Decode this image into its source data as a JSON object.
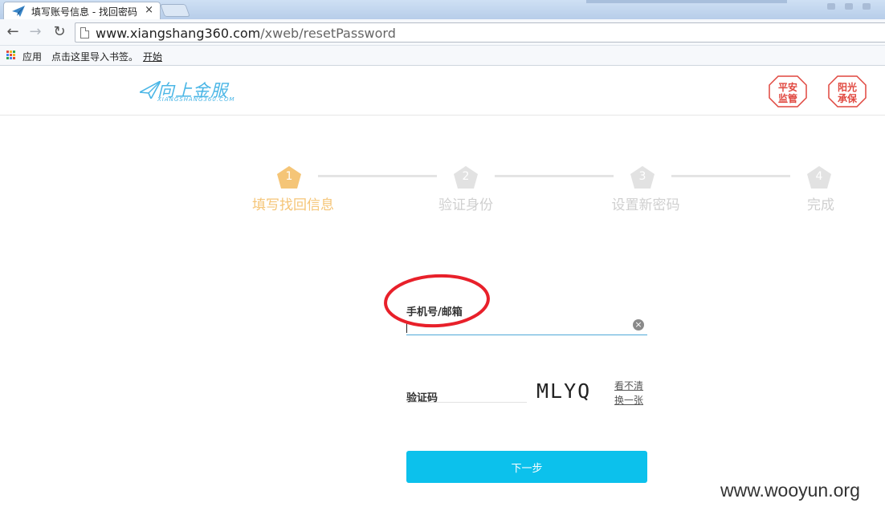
{
  "browser": {
    "tab_title": "填写账号信息 - 找回密码",
    "tab_close": "×",
    "url_host": "www.xiangshang360.com",
    "url_path": "/xweb/resetPassword",
    "bookmarks": {
      "apps": "应用",
      "import": "点击这里导入书签。",
      "start": "开始"
    },
    "apps_colors": [
      "#e04b3b",
      "#f3b61f",
      "#2ea44f",
      "#4285f4",
      "#e04b3b",
      "#f3b61f",
      "#2ea44f",
      "#4285f4",
      "#e04b3b"
    ]
  },
  "header": {
    "logo_text": "向上金服",
    "logo_sub": "XIANGSHANG360.COM",
    "badges": [
      {
        "line1": "平安",
        "line2": "监管"
      },
      {
        "line1": "阳光",
        "line2": "承保"
      }
    ],
    "badge_color": "#e0473f",
    "brand_color": "#4ab6e6"
  },
  "stepper": {
    "steps": [
      {
        "num": "1",
        "label": "填写找回信息",
        "active": true
      },
      {
        "num": "2",
        "label": "验证身份",
        "active": false
      },
      {
        "num": "3",
        "label": "设置新密码",
        "active": false
      },
      {
        "num": "4",
        "label": "完成",
        "active": false
      }
    ],
    "active_color": "#f5c577",
    "inactive_color": "#e2e2e2"
  },
  "form": {
    "phone_label": "手机号/邮箱",
    "phone_value": "",
    "clear_icon": "×",
    "code_label": "验证码",
    "code_value": "",
    "captcha_text": "MLYQ",
    "captcha_links": [
      "看不清",
      "换一张"
    ],
    "next_label": "下一步",
    "button_color": "#0cc1ec"
  },
  "annotation_color": "#e8202a",
  "watermark": "www.wooyun.org"
}
